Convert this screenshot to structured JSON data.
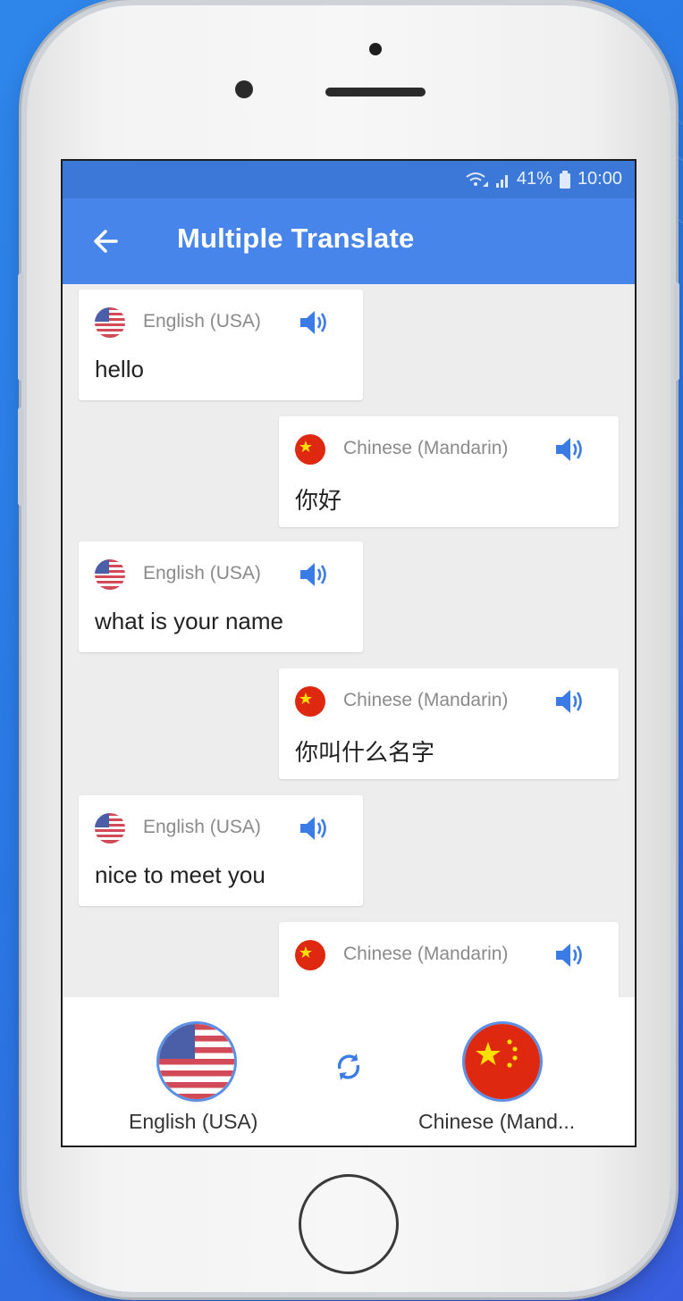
{
  "status_bar": {
    "battery": "41%",
    "time": "10:00"
  },
  "app_bar": {
    "title": "Multiple Translate"
  },
  "messages": [
    {
      "side": "left",
      "language": "English (USA)",
      "text": "hello",
      "flag": "usa-flag"
    },
    {
      "side": "right",
      "language": "Chinese (Mandarin)",
      "text": "你好",
      "flag": "china-flag"
    },
    {
      "side": "left",
      "language": "English (USA)",
      "text": "what is your name",
      "flag": "usa-flag"
    },
    {
      "side": "right",
      "language": "Chinese (Mandarin)",
      "text": "你叫什么名字",
      "flag": "china-flag"
    },
    {
      "side": "left",
      "language": "English (USA)",
      "text": "nice to meet you",
      "flag": "usa-flag"
    },
    {
      "side": "right",
      "language": "Chinese (Mandarin)",
      "text": "",
      "flag": "china-flag"
    }
  ],
  "bottom_bar": {
    "source_language": "English (USA)",
    "target_language": "Chinese (Mand..."
  },
  "colors": {
    "status_bar": "#3c78d8",
    "app_bar": "#4785ea",
    "accent_icon": "#3b7be6",
    "background": "#2f86ea"
  },
  "icons": [
    "back-arrow-icon",
    "speaker-icon",
    "swap-icon",
    "usa-flag-icon",
    "china-flag-icon",
    "wifi-icon",
    "signal-icon",
    "battery-icon"
  ]
}
